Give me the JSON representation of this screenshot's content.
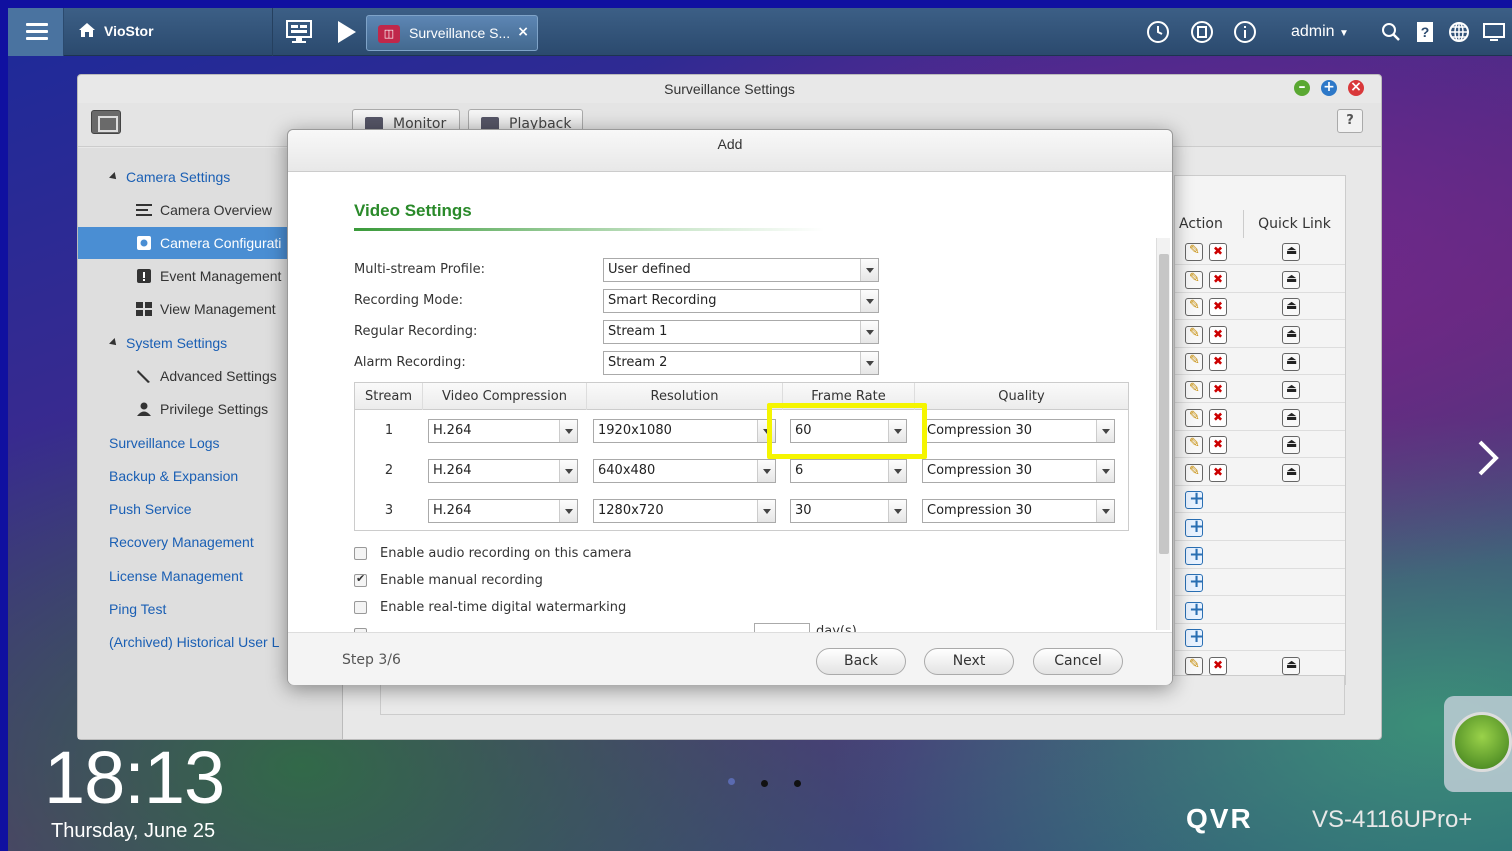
{
  "taskbar": {
    "app_name": "VioStor",
    "open_tab_label": "Surveillance S...",
    "user": "admin"
  },
  "window": {
    "title": "Surveillance Settings",
    "tabs": [
      "Monitor",
      "Playback"
    ],
    "help_label": "?"
  },
  "sidebar": {
    "camera_settings": "Camera Settings",
    "camera_overview": "Camera Overview",
    "camera_configuration": "Camera Configurati",
    "event_management": "Event Management",
    "view_management": "View Management",
    "system_settings": "System Settings",
    "advanced_settings": "Advanced Settings",
    "privilege_settings": "Privilege Settings",
    "links": [
      "Surveillance Logs",
      "Backup & Expansion",
      "Push Service",
      "Recovery Management",
      "License Management",
      "Ping Test",
      "(Archived) Historical User L"
    ]
  },
  "camera_grid": {
    "col_action": "Action",
    "col_quick_link": "Quick Link"
  },
  "dialog": {
    "title": "Add",
    "section_title": "Video Settings",
    "fields": {
      "multistream_label": "Multi-stream Profile:",
      "multistream_value": "User defined",
      "recording_mode_label": "Recording Mode:",
      "recording_mode_value": "Smart Recording",
      "regular_recording_label": "Regular Recording:",
      "regular_recording_value": "Stream 1",
      "alarm_recording_label": "Alarm Recording:",
      "alarm_recording_value": "Stream 2"
    },
    "stream_table": {
      "headers": [
        "Stream",
        "Video Compression",
        "Resolution",
        "Frame Rate",
        "Quality"
      ],
      "rows": [
        {
          "stream": "1",
          "compression": "H.264",
          "resolution": "1920x1080",
          "frame_rate": "60",
          "quality": "Compression 30"
        },
        {
          "stream": "2",
          "compression": "H.264",
          "resolution": "640x480",
          "frame_rate": "6",
          "quality": "Compression 30"
        },
        {
          "stream": "3",
          "compression": "H.264",
          "resolution": "1280x720",
          "frame_rate": "30",
          "quality": "Compression 30"
        }
      ]
    },
    "options": {
      "audio": "Enable audio recording on this camera",
      "manual": "Enable manual recording",
      "watermark": "Enable real-time digital watermarking",
      "partial_unit": "day(s)"
    },
    "footer": {
      "step": "Step 3/6",
      "back": "Back",
      "next": "Next",
      "cancel": "Cancel"
    }
  },
  "desktop": {
    "time": "18:13",
    "date": "Thursday, June 25",
    "brand": "QVR",
    "model": "VS-4116UPro+"
  },
  "colors": {
    "accent_green": "#2a8a2a",
    "link_blue": "#1a5fb4",
    "highlight": "#f5f500",
    "selected_row": "#4a8ed3"
  }
}
